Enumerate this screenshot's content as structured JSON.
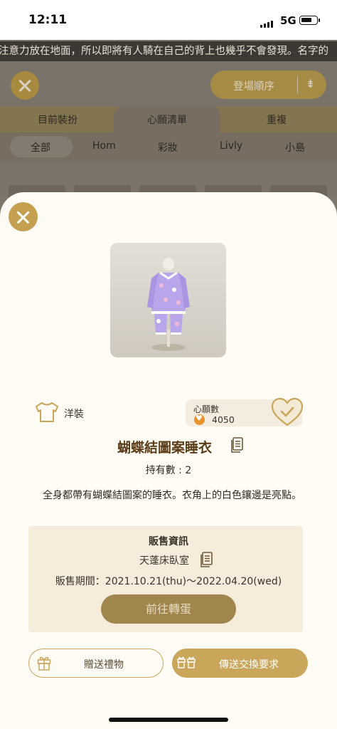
{
  "status_bar": {
    "time": "12:11",
    "network": "5G"
  },
  "marquee": {
    "text": "注意力放在地面，所以即將有人騎在自己的背上也幾乎不會發現。名字的"
  },
  "background": {
    "sort_button_label": "登場順序",
    "tabs": [
      "目前裝扮",
      "心願清單",
      "重複"
    ],
    "filters": [
      "全部",
      "Hom",
      "彩妝",
      "Livly",
      "小島"
    ]
  },
  "item": {
    "category": "洋裝",
    "wish_label": "心願數",
    "wish_count": "4050",
    "name": "蝴蝶結圖案睡衣",
    "owned": "持有數 : 2",
    "description": "全身都帶有蝴蝶結圖案的睡衣。衣角上的白色鑲邊是亮點。"
  },
  "sale": {
    "title": "販售資訊",
    "place": "天蓬床臥室",
    "period": "販售期間：2021.10.21(thu)〜2022.04.20(wed)",
    "button_label": "前往轉蛋"
  },
  "actions": {
    "gift_label": "贈送禮物",
    "trade_label": "傳送交換要求"
  },
  "colors": {
    "gold": "#c9a65a",
    "sheet_bg": "#fffcf6",
    "sale_bg": "#f5ecdc",
    "dim_gold_button": "#a0864c"
  }
}
